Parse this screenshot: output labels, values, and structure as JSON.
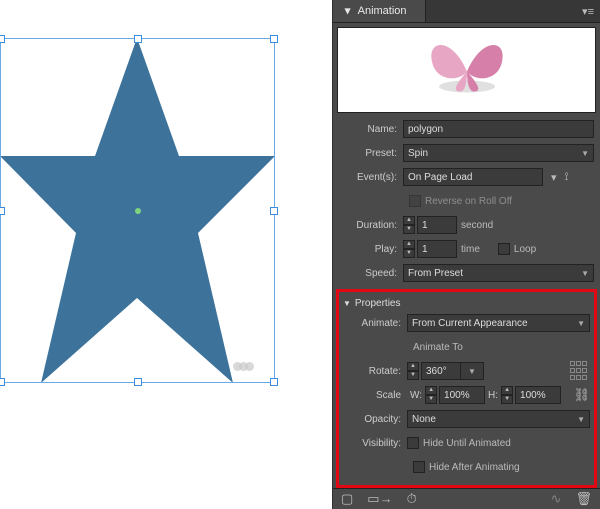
{
  "panel": {
    "title": "Animation",
    "name_label": "Name:",
    "name_value": "polygon",
    "preset_label": "Preset:",
    "preset_value": "Spin",
    "events_label": "Event(s):",
    "events_value": "On Page Load",
    "reverse_label": "Reverse on Roll Off",
    "duration_label": "Duration:",
    "duration_value": "1",
    "duration_unit": "second",
    "play_label": "Play:",
    "play_value": "1",
    "play_unit": "time",
    "loop_label": "Loop",
    "speed_label": "Speed:",
    "speed_value": "From Preset"
  },
  "props": {
    "section": "Properties",
    "animate_label": "Animate:",
    "animate_value": "From Current Appearance",
    "subhead": "Animate To",
    "rotate_label": "Rotate:",
    "rotate_value": "360°",
    "scale_label": "Scale",
    "scale_w_label": "W:",
    "scale_w_value": "100%",
    "scale_h_label": "H:",
    "scale_h_value": "100%",
    "opacity_label": "Opacity:",
    "opacity_value": "None",
    "visibility_label": "Visibility:",
    "hide_until": "Hide Until Animated",
    "hide_after": "Hide After Animating"
  },
  "canvas": {
    "object": "polygon-star"
  }
}
